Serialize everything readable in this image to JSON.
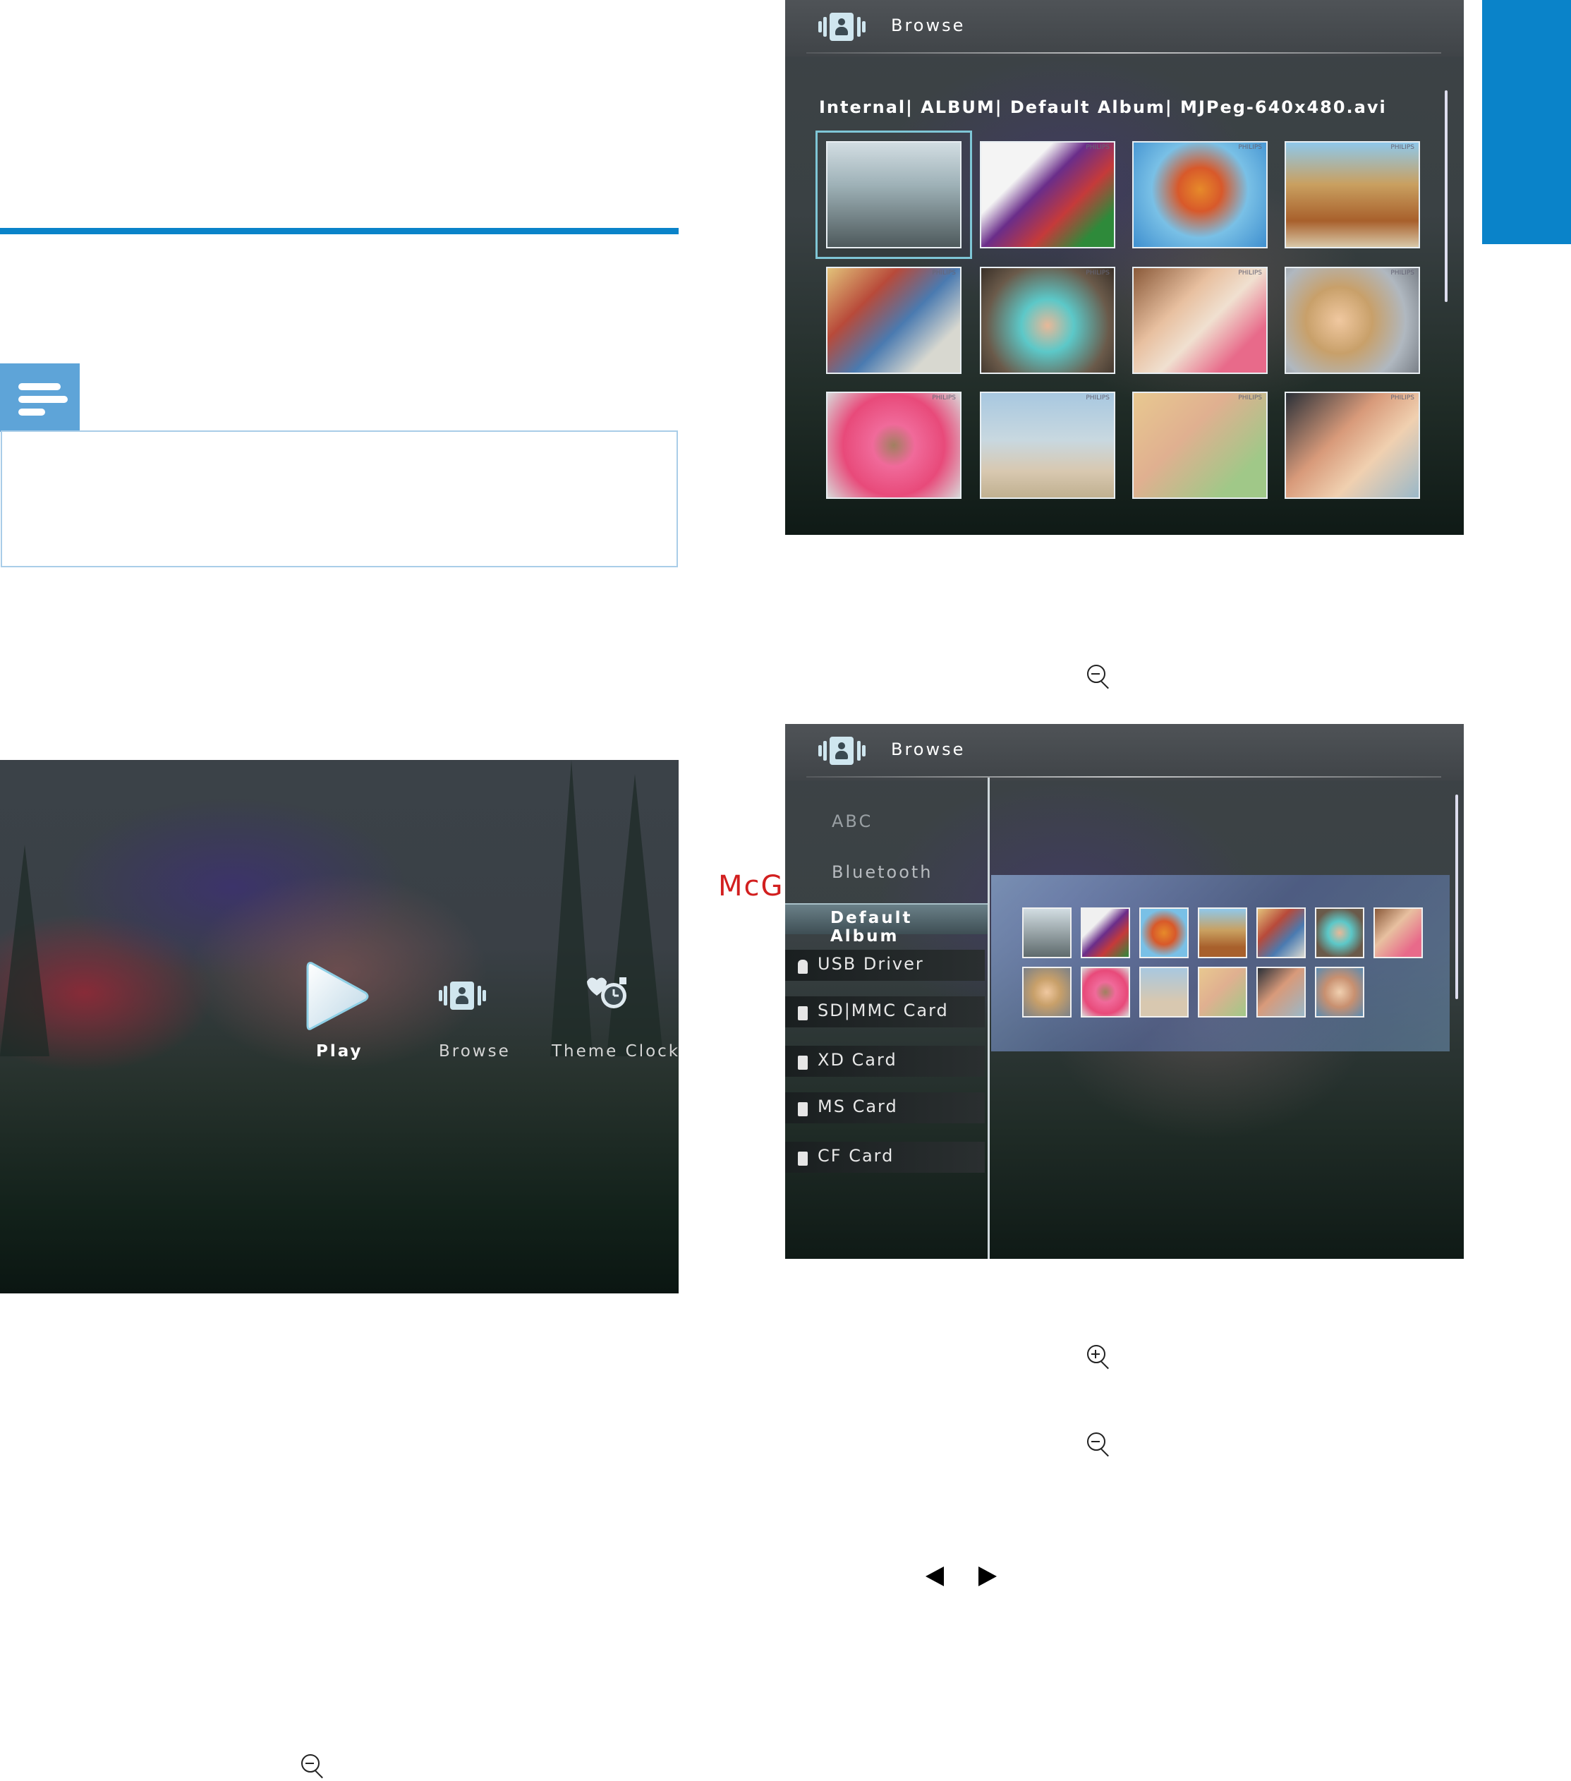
{
  "watermark": "McGrp.Ru",
  "home_screen": {
    "menu": [
      {
        "label": "Play",
        "icon": "play-icon"
      },
      {
        "label": "Browse",
        "icon": "browse-icon"
      },
      {
        "label": "Theme Clock",
        "icon": "theme-clock-icon"
      }
    ]
  },
  "browse_screen_1": {
    "title": "Browse",
    "path": "Internal| ALBUM| Default Album| MJPeg-640x480.avi",
    "thumb_brand": "PHILIPS"
  },
  "browse_screen_2": {
    "title": "Browse",
    "sources": [
      "ABC",
      "Bluetooth",
      "Default Album",
      "USB Driver",
      "SD|MMC Card",
      "XD Card",
      "MS Card",
      "CF Card"
    ],
    "selected_source": "Default Album"
  },
  "icons": {
    "zoom_out": "zoom-out-icon",
    "zoom_in": "zoom-in-icon",
    "left": "left-arrow-icon",
    "right": "right-arrow-icon",
    "note": "note-icon"
  },
  "colors": {
    "accent": "#0a83c9",
    "note_tab": "#5ea4d8",
    "note_border": "#a9cde8"
  }
}
